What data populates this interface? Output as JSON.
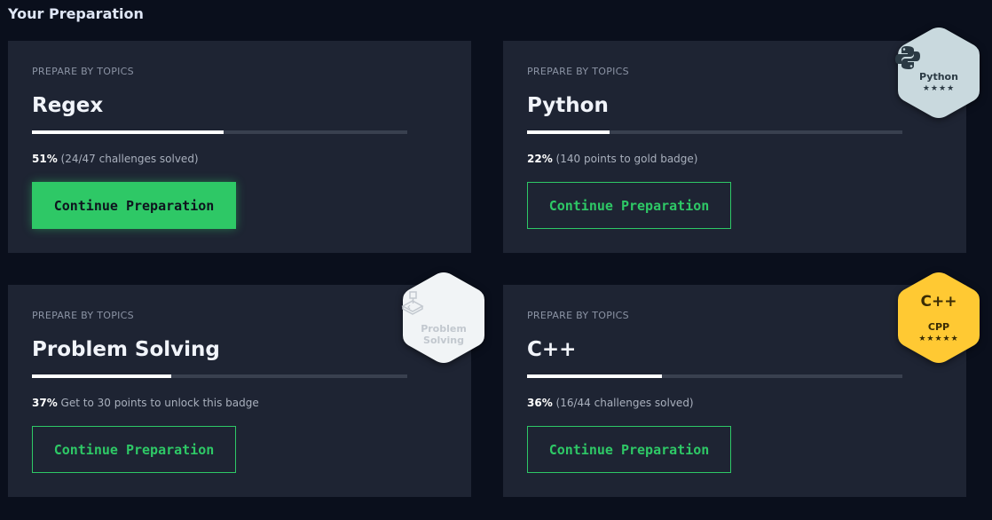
{
  "header": {
    "title": "Your Preparation"
  },
  "colors": {
    "background": "#0a0f1c",
    "card": "#1e2433",
    "accent": "#2ec866"
  },
  "cards": [
    {
      "eyebrow": "PREPARE BY TOPICS",
      "topic": "Regex",
      "progress_percent": 51,
      "pct_text": "51%",
      "detail": " (24/47 challenges solved)",
      "button": "Continue Preparation",
      "button_style": "solid"
    },
    {
      "eyebrow": "PREPARE BY TOPICS",
      "topic": "Python",
      "progress_percent": 22,
      "pct_text": "22%",
      "detail": " (140 points to gold badge)",
      "button": "Continue Preparation",
      "button_style": "outline"
    },
    {
      "eyebrow": "PREPARE BY TOPICS",
      "topic": "Problem Solving",
      "progress_percent": 37,
      "pct_text": "37%",
      "detail": " Get to 30 points to unlock this badge",
      "button": "Continue Preparation",
      "button_style": "outline"
    },
    {
      "eyebrow": "PREPARE BY TOPICS",
      "topic": "C++",
      "progress_percent": 36,
      "pct_text": "36%",
      "detail": " (16/44 challenges solved)",
      "button": "Continue Preparation",
      "button_style": "outline"
    }
  ],
  "badges": {
    "python": {
      "name": "Python",
      "stars": "★★★★",
      "icon": "python-logo-icon",
      "fill": "#c9d9de",
      "text_color": "#2b3a44"
    },
    "problem_solving": {
      "name": "Problem Solving",
      "stars": "",
      "icon": "problem-solving-icon",
      "fill": "#f1f4f6",
      "text_color": "#c2c8cf"
    },
    "cpp": {
      "name": "CPP",
      "stars": "★★★★★",
      "icon": "cpp-logo-icon",
      "icon_text": "C++",
      "fill": "#ffc933",
      "text_color": "#3a2c05"
    }
  }
}
